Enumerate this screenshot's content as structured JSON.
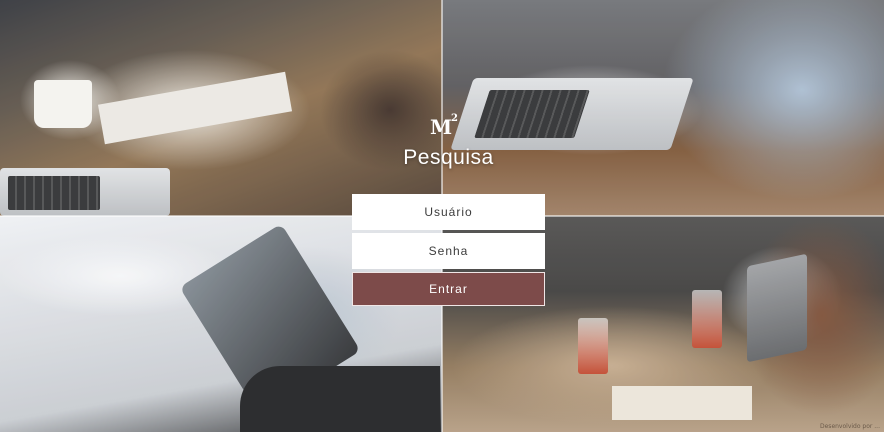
{
  "logo": {
    "mark": "M",
    "superscript": "2"
  },
  "title": "Pesquisa",
  "login": {
    "username_placeholder": "Usuário",
    "password_placeholder": "Senha",
    "submit_label": "Entrar"
  },
  "photo_credit": "Desenvolvido por ..."
}
